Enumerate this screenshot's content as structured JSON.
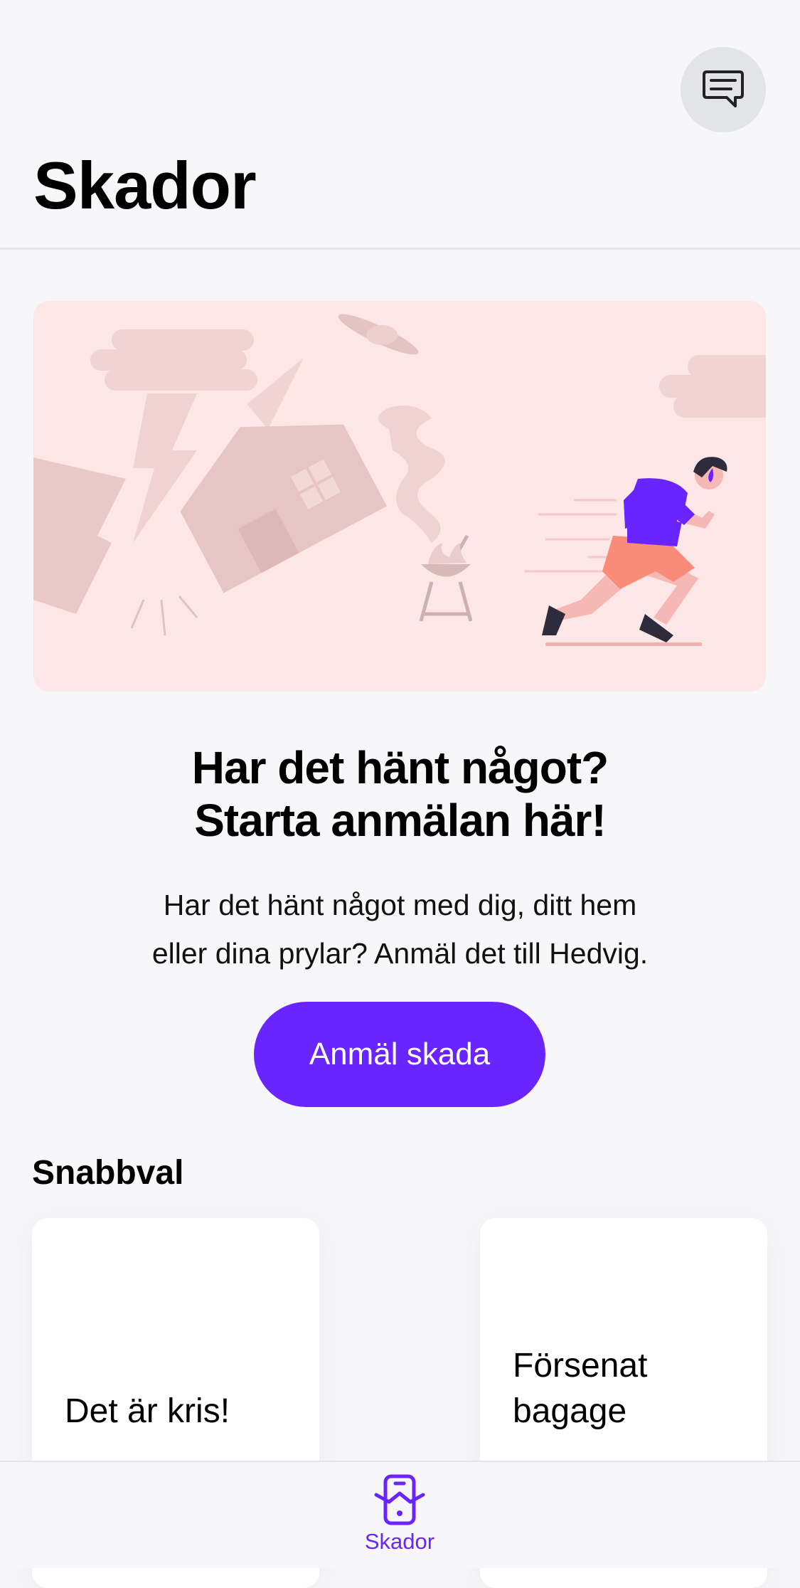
{
  "header": {
    "title": "Skador",
    "chat_icon": "chat-bubble-icon"
  },
  "hero": {
    "illustration": "person-running-from-disasters",
    "headline_lines": [
      "Har det hänt något?",
      "Starta anmälan här!"
    ],
    "description_lines": [
      "Har det hänt något med dig, ditt hem",
      "eller dina prylar? Anmäl det till Hedvig."
    ],
    "cta_label": "Anmäl skada"
  },
  "quick": {
    "title": "Snabbval",
    "cards": [
      {
        "label": "Det är kris!"
      },
      {
        "label_lines": [
          "Försenat",
          "bagage"
        ]
      }
    ]
  },
  "tabbar": {
    "items": [
      {
        "label": "Skador",
        "icon": "phone-claims-icon",
        "active": true
      }
    ]
  },
  "colors": {
    "accent": "#6A24FF",
    "hero_bg": "#FDE7E6",
    "background": "#F7F7F9"
  }
}
